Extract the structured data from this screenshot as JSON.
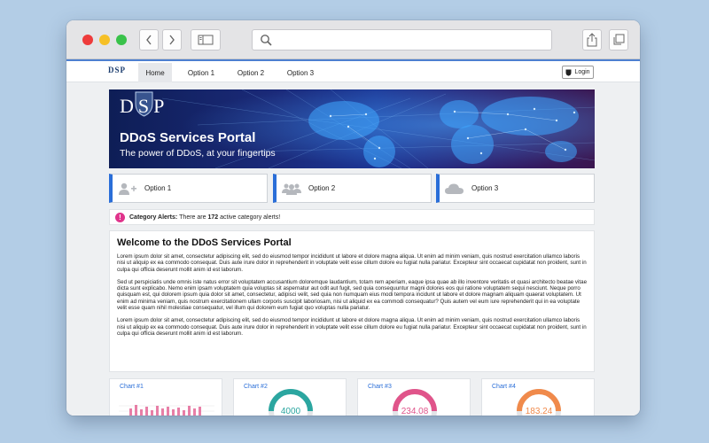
{
  "site": {
    "logo": "DSP",
    "nav": [
      {
        "label": "Home",
        "active": true
      },
      {
        "label": "Option 1",
        "active": false
      },
      {
        "label": "Option 2",
        "active": false
      },
      {
        "label": "Option 3",
        "active": false
      }
    ],
    "login_label": "Login"
  },
  "hero": {
    "logo": "DSP",
    "title": "DDoS Services Portal",
    "subtitle": "The power of DDoS, at your fingertips"
  },
  "options": [
    {
      "label": "Option 1",
      "icon": "add-user-icon"
    },
    {
      "label": "Option 2",
      "icon": "group-icon"
    },
    {
      "label": "Option 3",
      "icon": "cloud-icon"
    }
  ],
  "alert": {
    "label": "Category Alerts:",
    "text_before": "There are",
    "count": "172",
    "text_after": "active category alerts!"
  },
  "welcome": {
    "title": "Welcome to the DDoS Services Portal",
    "paragraphs": [
      "Lorem ipsum dolor sit amet, consectetur adipiscing elit, sed do eiusmod tempor incididunt ut labore et dolore magna aliqua. Ut enim ad minim veniam, quis nostrud exercitation ullamco laboris nisi ut aliquip ex ea commodo consequat. Duis aute irure dolor in reprehenderit in voluptate velit esse cillum dolore eu fugiat nulla pariatur. Excepteur sint occaecat cupidatat non proident, sunt in culpa qui officia deserunt mollit anim id est laborum.",
      "Sed ut perspiciatis unde omnis iste natus error sit voluptatem accusantium doloremque laudantium, totam rem aperiam, eaque ipsa quae ab illo inventore veritatis et quasi architecto beatae vitae dicta sunt explicabo. Nemo enim ipsam voluptatem quia voluptas sit aspernatur aut odit aut fugit, sed quia consequuntur magni dolores eos qui ratione voluptatem sequi nesciunt. Neque porro quisquam est, qui dolorem ipsum quia dolor sit amet, consectetur, adipisci velit, sed quia non numquam eius modi tempora incidunt ut labore et dolore magnam aliquam quaerat voluptatem. Ut enim ad minima veniam, quis nostrum exercitationem ullam corporis suscipit laboriosam, nisi ut aliquid ex ea commodi consequatur? Quis autem vel eum iure reprehenderit qui in ea voluptate velit esse quam nihil molestiae consequatur, vel illum qui dolorem eum fugiat quo voluptas nulla pariatur.",
      "Lorem ipsum dolor sit amet, consectetur adipiscing elit, sed do eiusmod tempor incididunt ut labore et dolore magna aliqua. Ut enim ad minim veniam, quis nostrud exercitation ullamco laboris nisi ut aliquip ex ea commodo consequat. Duis aute irure dolor in reprehenderit in voluptate velit esse cillum dolore eu fugiat nulla pariatur. Excepteur sint occaecat cupidatat non proident, sunt in culpa qui officia deserunt mollit anim id est laborum."
    ]
  },
  "charts": [
    {
      "title": "Chart #1",
      "kind": "bars",
      "color": "#e0548a"
    },
    {
      "title": "Chart #2",
      "kind": "gauge",
      "value": "4000",
      "color": "#2ba6a0"
    },
    {
      "title": "Chart #3",
      "kind": "gauge",
      "value": "234.08",
      "color": "#e0548a"
    },
    {
      "title": "Chart #4",
      "kind": "gauge",
      "value": "183.24",
      "color": "#f08a4b"
    }
  ],
  "colors": {
    "accent": "#2a6ed8",
    "alert": "#e0348c",
    "hero_dark": "#0e1e56"
  }
}
